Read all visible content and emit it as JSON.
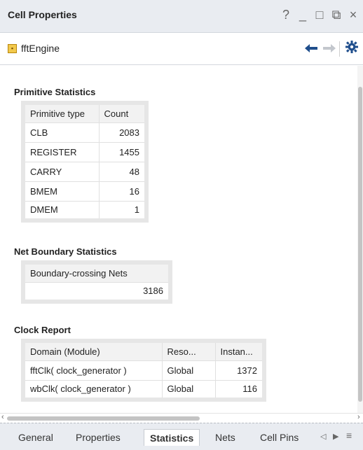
{
  "window": {
    "title": "Cell Properties",
    "controls": [
      "?",
      "_",
      "□",
      "⧉",
      "×"
    ]
  },
  "toolbar": {
    "object_name": "fftEngine",
    "back_icon": "arrow-left-icon",
    "forward_icon": "arrow-right-icon",
    "settings_icon": "gear-icon",
    "accent": "#1f4e8c"
  },
  "primitive_statistics": {
    "title": "Primitive Statistics",
    "headers": [
      "Primitive type",
      "Count"
    ],
    "rows": [
      [
        "CLB",
        "2083"
      ],
      [
        "REGISTER",
        "1455"
      ],
      [
        "CARRY",
        "48"
      ],
      [
        "BMEM",
        "16"
      ],
      [
        "DMEM",
        "1"
      ]
    ]
  },
  "net_boundary": {
    "title": "Net Boundary Statistics",
    "headers": [
      "Boundary-crossing Nets"
    ],
    "rows": [
      [
        "3186"
      ]
    ]
  },
  "clock_report": {
    "title": "Clock Report",
    "headers": [
      "Domain (Module)",
      "Reso...",
      "Instan..."
    ],
    "rows": [
      [
        "fftClk( clock_generator )",
        "Global",
        "1372"
      ],
      [
        "wbClk( clock_generator )",
        "Global",
        "116"
      ]
    ]
  },
  "tabs": {
    "items": [
      "General",
      "Properties",
      "Statistics",
      "Nets",
      "Cell Pins"
    ],
    "active": "Statistics"
  }
}
